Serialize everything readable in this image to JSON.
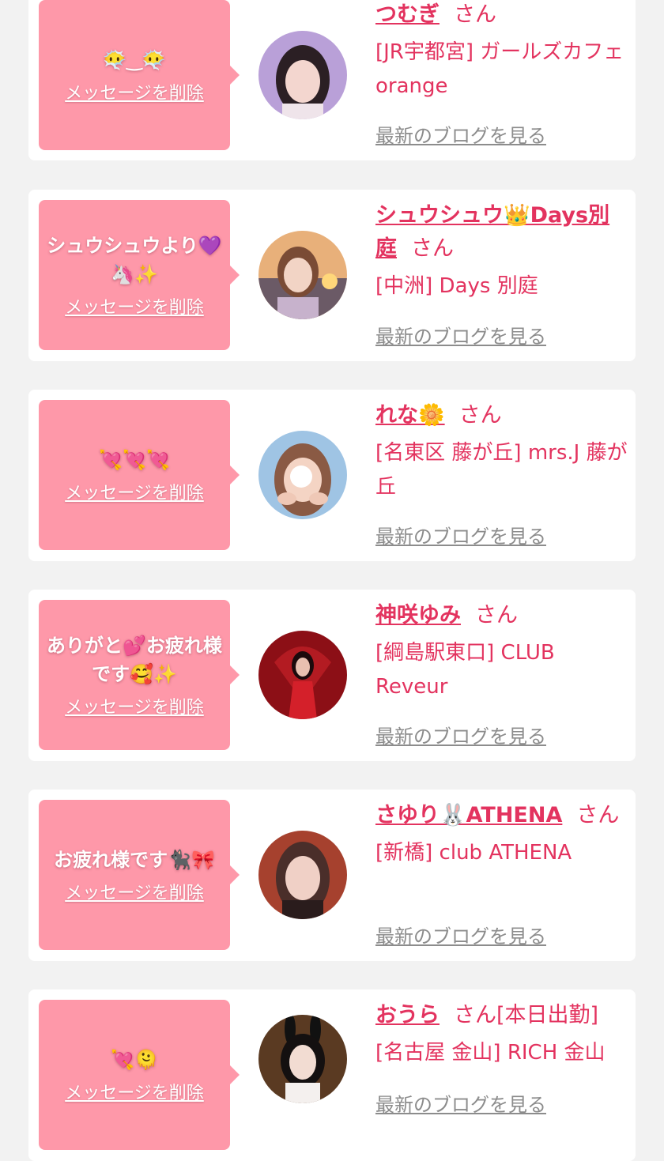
{
  "delete_label": "メッセージを削除",
  "blog_label": "最新のブログを見る",
  "suffix": "さん",
  "colors": {
    "background": "#f2f2f2",
    "card": "#ffffff",
    "bubble": "#fe98a9",
    "name": "#e3335f",
    "link_gray": "#8c8c8c"
  },
  "entries": [
    {
      "message": "😶‍🌫️‿😶‍🌫️",
      "name": "つむぎ",
      "shop": "[JR宇都宮] ガールズカフェ orange",
      "avatar_icon": "woman-portrait-purple"
    },
    {
      "message": "シュウシュウより💜🦄✨",
      "name": "シュウシュウ👑Days別庭",
      "shop": "[中洲] Days 別庭",
      "avatar_icon": "woman-portrait-sunset"
    },
    {
      "message": "💘💘💘",
      "name": "れな🌼",
      "shop": "[名東区 藤が丘] mrs.J 藤が丘",
      "avatar_icon": "woman-portrait-heart-hands"
    },
    {
      "message": "ありがと💕お疲れ様です🥰✨",
      "name": "神咲ゆみ",
      "shop": "[綱島駅東口] CLUB Reveur",
      "avatar_icon": "woman-portrait-red"
    },
    {
      "message": "お疲れ様です🐈‍⬛🎀",
      "name": "さゆり🐰ATHENA",
      "shop": "[新橋] club ATHENA",
      "avatar_icon": "woman-portrait-blurred"
    },
    {
      "message": "💘🫠",
      "name": "おうら",
      "after_san": "[本日出勤]",
      "shop": "[名古屋 金山] RICH 金山",
      "avatar_icon": "woman-portrait-bunny"
    }
  ]
}
